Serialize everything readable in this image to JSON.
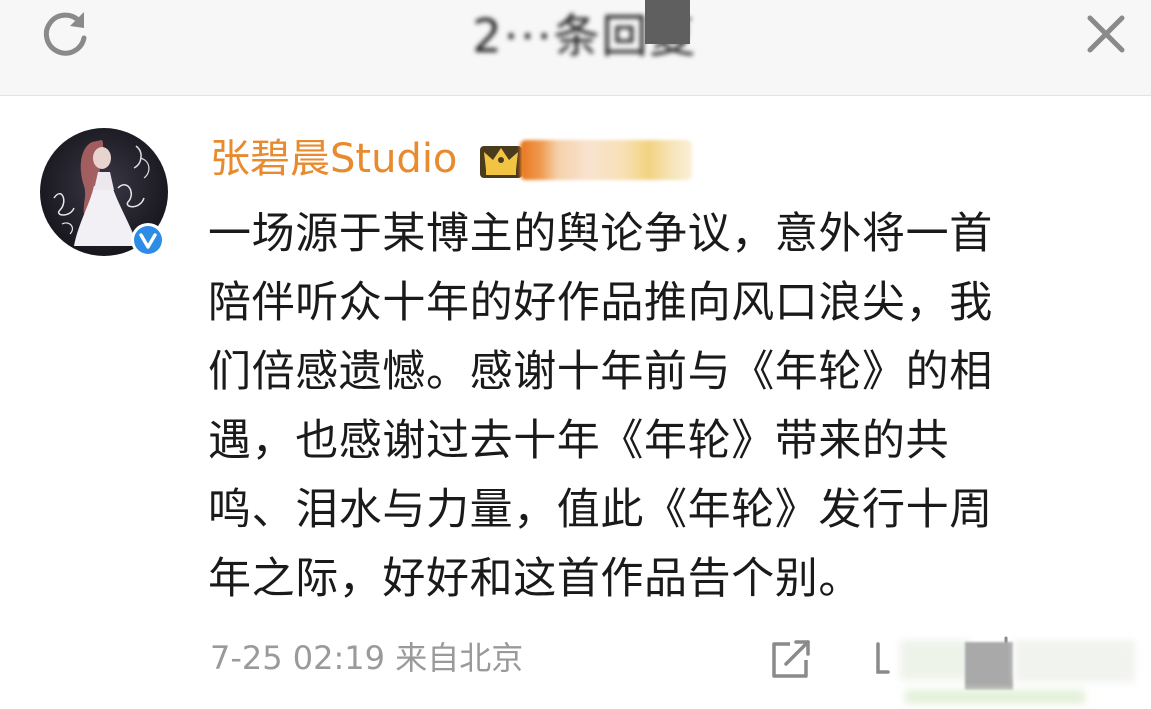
{
  "header": {
    "title": "2···条回复",
    "refresh_icon": "refresh-icon",
    "close_icon": "close-icon"
  },
  "post": {
    "username": "张碧晨Studio",
    "verified_icon": "verified-badge-icon",
    "vip_icon": "crown-vip-icon",
    "body_lines": [
      "一场源于某博主的舆论争议，意外将一首",
      "陪伴听众十年的好作品推向风口浪尖，我",
      "们倍感遗憾。感谢十年前与《年轮》的相",
      "遇，也感谢过去十年《年轮》带来的共",
      "鸣、泪水与力量，值此《年轮》发行十周",
      "年之际，好好和这首作品告个别。"
    ],
    "timestamp": "7-25 02:19",
    "source": "来自北京",
    "actions": {
      "share_icon": "share-icon",
      "comment_icon": "comment-icon",
      "like_icon": "like-icon"
    }
  },
  "colors": {
    "username": "#e88a2e",
    "body_text": "#1a1a1a",
    "meta_text": "#9a9a9a",
    "header_bg": "#f7f7f7",
    "verified_blue": "#2d8ce5",
    "icon_gray": "#8a8a8a"
  }
}
